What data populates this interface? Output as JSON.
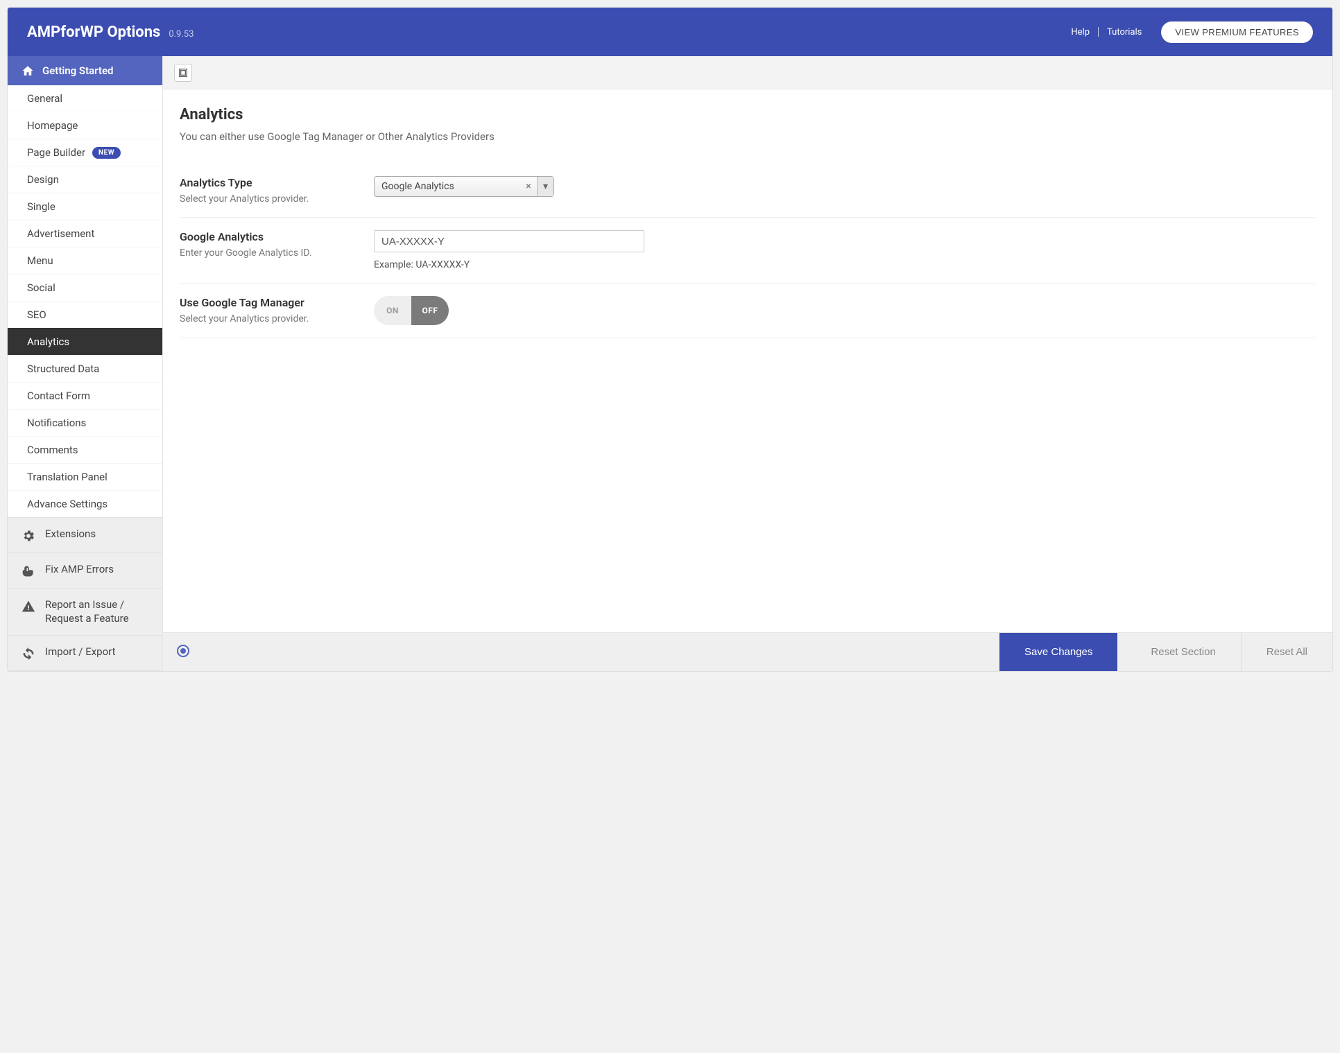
{
  "header": {
    "title": "AMPforWP Options",
    "version": "0.9.53",
    "help": "Help",
    "tutorials": "Tutorials",
    "premium_button": "VIEW PREMIUM FEATURES"
  },
  "sidebar": {
    "header": "Getting Started",
    "items": [
      {
        "label": "General"
      },
      {
        "label": "Homepage"
      },
      {
        "label": "Page Builder",
        "badge": "NEW"
      },
      {
        "label": "Design"
      },
      {
        "label": "Single"
      },
      {
        "label": "Advertisement"
      },
      {
        "label": "Menu"
      },
      {
        "label": "Social"
      },
      {
        "label": "SEO"
      },
      {
        "label": "Analytics",
        "active": true
      },
      {
        "label": "Structured Data"
      },
      {
        "label": "Contact Form"
      },
      {
        "label": "Notifications"
      },
      {
        "label": "Comments"
      },
      {
        "label": "Translation Panel"
      },
      {
        "label": "Advance Settings"
      }
    ],
    "utils": [
      {
        "label": "Extensions",
        "icon": "gear"
      },
      {
        "label": "Fix AMP Errors",
        "icon": "point"
      },
      {
        "label": "Report an Issue / Request a Feature",
        "icon": "warning"
      },
      {
        "label": "Import / Export",
        "icon": "refresh"
      }
    ]
  },
  "main": {
    "section_title": "Analytics",
    "section_desc": "You can either use Google Tag Manager or Other Analytics Providers",
    "fields": {
      "analytics_type": {
        "title": "Analytics Type",
        "desc": "Select your Analytics provider.",
        "value": "Google Analytics"
      },
      "ga": {
        "title": "Google Analytics",
        "desc": "Enter your Google Analytics ID.",
        "value": "UA-XXXXX-Y",
        "help": "Example: UA-XXXXX-Y"
      },
      "gtm": {
        "title": "Use Google Tag Manager",
        "desc": "Select your Analytics provider.",
        "on": "ON",
        "off": "OFF",
        "state": "off"
      }
    }
  },
  "footer": {
    "save": "Save Changes",
    "reset_section": "Reset Section",
    "reset_all": "Reset All"
  }
}
